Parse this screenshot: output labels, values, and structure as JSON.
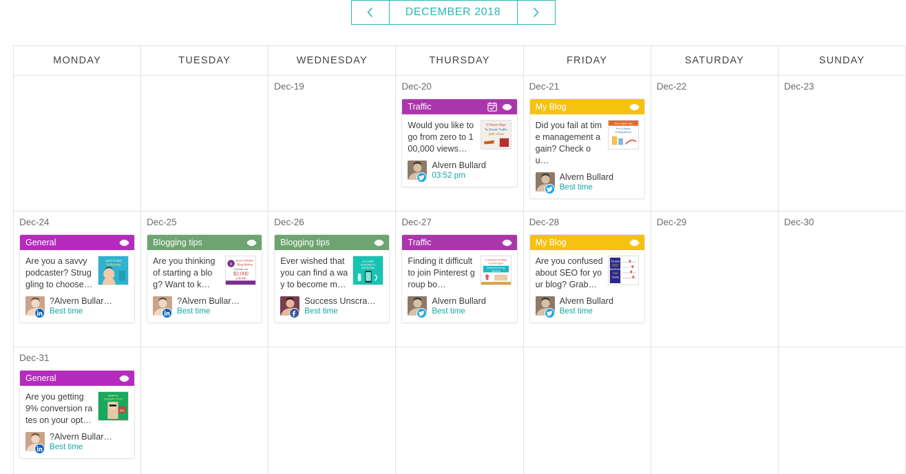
{
  "nav": {
    "prev_icon": "chevron-left-icon",
    "next_icon": "chevron-right-icon",
    "month_label": "DECEMBER 2018",
    "accent_color": "#29b6b6"
  },
  "weekdays": [
    "MONDAY",
    "TUESDAY",
    "WEDNESDAY",
    "THURSDAY",
    "FRIDAY",
    "SATURDAY",
    "SUNDAY"
  ],
  "category_colors": {
    "Traffic": "#ab36ab",
    "My Blog": "#f5c211",
    "General": "#b52bbd",
    "Blogging tips": "#6da471"
  },
  "weeks": [
    {
      "days": [
        {
          "label": "",
          "posts": []
        },
        {
          "label": "",
          "posts": []
        },
        {
          "label": "Dec-19",
          "posts": []
        },
        {
          "label": "Dec-20",
          "posts": [
            {
              "category": "Traffic",
              "color": "#ab36ab",
              "icons": [
                "calendar-check-icon",
                "eye-icon"
              ],
              "text": "Would you like to go from zero to 100,000 views…",
              "thumb": "thumb-traffic-views",
              "author": "Alvern Bullard",
              "network": "twitter",
              "time": "03:52 pm"
            }
          ]
        },
        {
          "label": "Dec-21",
          "posts": [
            {
              "category": "My Blog",
              "color": "#f5c211",
              "icons": [
                "eye-icon"
              ],
              "text": "Did you fail at time management again? Check ou…",
              "thumb": "thumb-time-management",
              "author": "Alvern Bullard",
              "network": "twitter",
              "time": "Best time"
            }
          ]
        },
        {
          "label": "Dec-22",
          "posts": []
        },
        {
          "label": "Dec-23",
          "posts": []
        }
      ]
    },
    {
      "days": [
        {
          "label": "Dec-24",
          "posts": [
            {
              "category": "General",
              "color": "#b52bbd",
              "icons": [
                "eye-icon"
              ],
              "text": "Are you a savvy podcaster? Struggling to choose…",
              "thumb": "thumb-podcaster",
              "author": "?Alvern Bullar…",
              "network": "linkedin",
              "time": "Best time"
            }
          ]
        },
        {
          "label": "Dec-25",
          "posts": [
            {
              "category": "Blogging tips",
              "color": "#6da471",
              "icons": [
                "eye-icon"
              ],
              "text": "Are you thinking of starting a blog? Want to k…",
              "thumb": "thumb-blog-money",
              "author": "?Alvern Bullar…",
              "network": "linkedin",
              "time": "Best time"
            }
          ]
        },
        {
          "label": "Dec-26",
          "posts": [
            {
              "category": "Blogging tips",
              "color": "#6da471",
              "icons": [
                "eye-icon"
              ],
              "text": "Ever wished that you can find a way to become m…",
              "thumb": "thumb-mobile-teal",
              "author": "Success Unscra…",
              "network": "facebook",
              "time": "Best time"
            }
          ]
        },
        {
          "label": "Dec-27",
          "posts": [
            {
              "category": "Traffic",
              "color": "#ab36ab",
              "icons": [
                "eye-icon"
              ],
              "text": "Finding it difficult to join Pinterest group bo…",
              "thumb": "thumb-pinterest-boards",
              "author": "Alvern Bullard",
              "network": "twitter",
              "time": "Best time"
            }
          ]
        },
        {
          "label": "Dec-28",
          "posts": [
            {
              "category": "My Blog",
              "color": "#f5c211",
              "icons": [
                "eye-icon"
              ],
              "text": "Are you confused about SEO for your blog? Grab…",
              "thumb": "thumb-seo-checklist",
              "author": "Alvern Bullard",
              "network": "twitter",
              "time": "Best time"
            }
          ]
        },
        {
          "label": "Dec-29",
          "posts": []
        },
        {
          "label": "Dec-30",
          "posts": []
        }
      ]
    },
    {
      "days": [
        {
          "label": "Dec-31",
          "posts": [
            {
              "category": "General",
              "color": "#b52bbd",
              "icons": [
                "eye-icon"
              ],
              "text": "Are you getting 9% conversion rates on your opt…",
              "thumb": "thumb-conversion-green",
              "author": "?Alvern Bullar…",
              "network": "linkedin",
              "time": "Best time"
            }
          ]
        },
        {
          "label": "",
          "posts": []
        },
        {
          "label": "",
          "posts": []
        },
        {
          "label": "",
          "posts": []
        },
        {
          "label": "",
          "posts": []
        },
        {
          "label": "",
          "posts": []
        },
        {
          "label": "",
          "posts": []
        }
      ]
    }
  ]
}
